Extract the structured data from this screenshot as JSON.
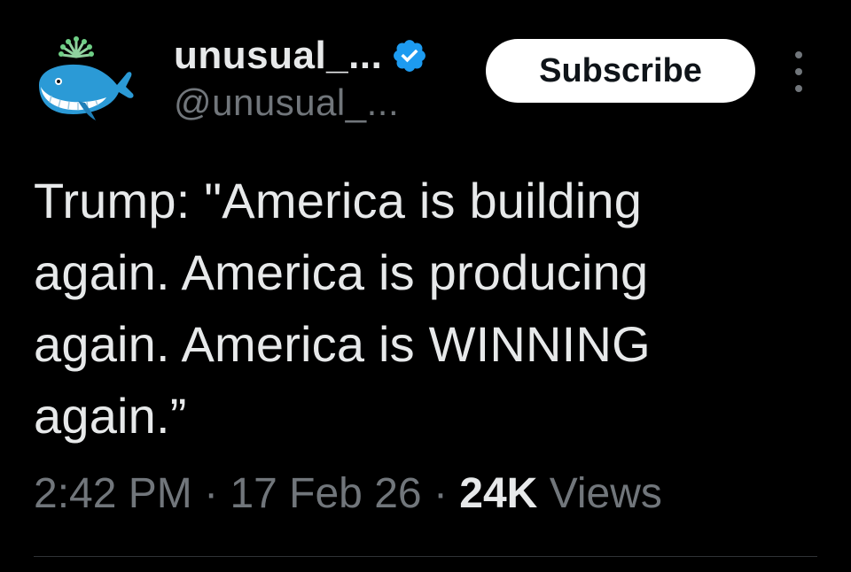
{
  "post": {
    "author": {
      "display_name": "unusual_...",
      "handle": "@unusual_...",
      "verified": true,
      "avatar_icon": "whale-icon",
      "verified_color": "#1d9bf0"
    },
    "subscribe_label": "Subscribe",
    "more_icon": "more-options-icon",
    "text": "Trump: \"America is building again. America is producing again. America is WINNING again.”",
    "meta": {
      "time": "2:42 PM",
      "separator": "·",
      "date": "17 Feb 26",
      "views_count": "24K",
      "views_label": "Views"
    }
  },
  "colors": {
    "background": "#000000",
    "primary_text": "#e7e9ea",
    "secondary_text": "#71767b",
    "button_bg": "#ffffff",
    "button_text": "#0f1419",
    "divider": "#2f3336"
  }
}
